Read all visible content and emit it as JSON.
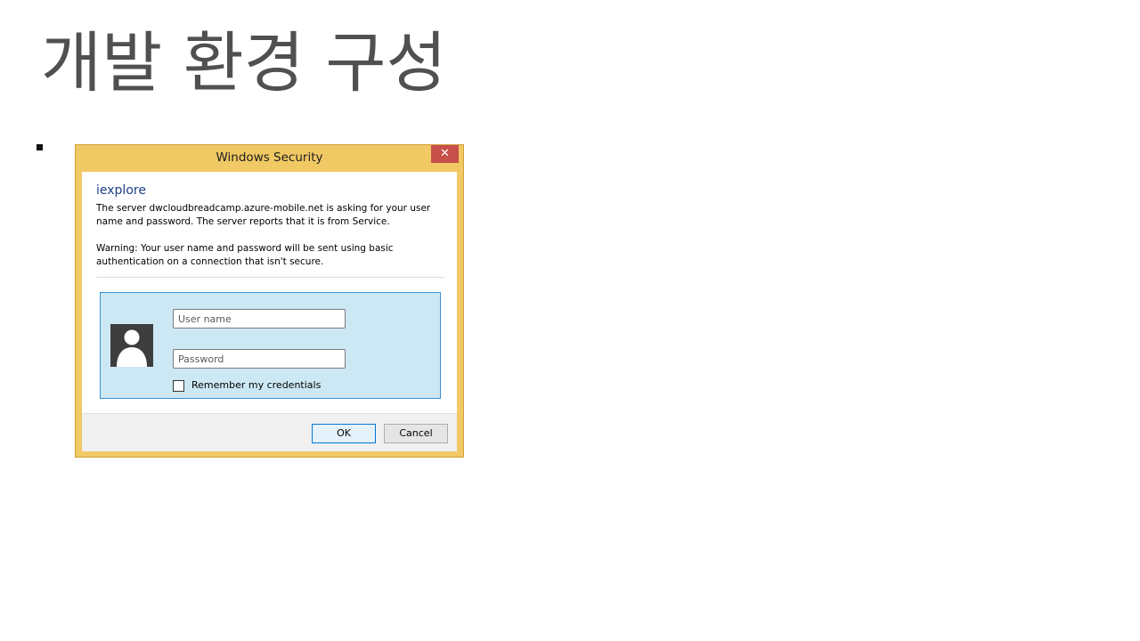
{
  "slide": {
    "title": "개발 환경 구성"
  },
  "dialog": {
    "title": "Windows Security",
    "close_glyph": "✕",
    "app_name": "iexplore",
    "message_line1": "The server dwcloudbreadcamp.azure-mobile.net is asking for your user name and password. The server reports that it is from Service.",
    "message_line2": "Warning: Your user name and password will be sent using basic authentication on a connection that isn't secure.",
    "username_placeholder": "User name",
    "password_placeholder": "Password",
    "remember_label": "Remember my credentials",
    "ok_label": "OK",
    "cancel_label": "Cancel",
    "avatar_icon": "user-icon",
    "colors": {
      "frame": "#f0c864",
      "close": "#c7504a",
      "tile": "#cce8f4",
      "tile_border": "#3c8fd4",
      "app_name": "#1e3f88"
    }
  }
}
